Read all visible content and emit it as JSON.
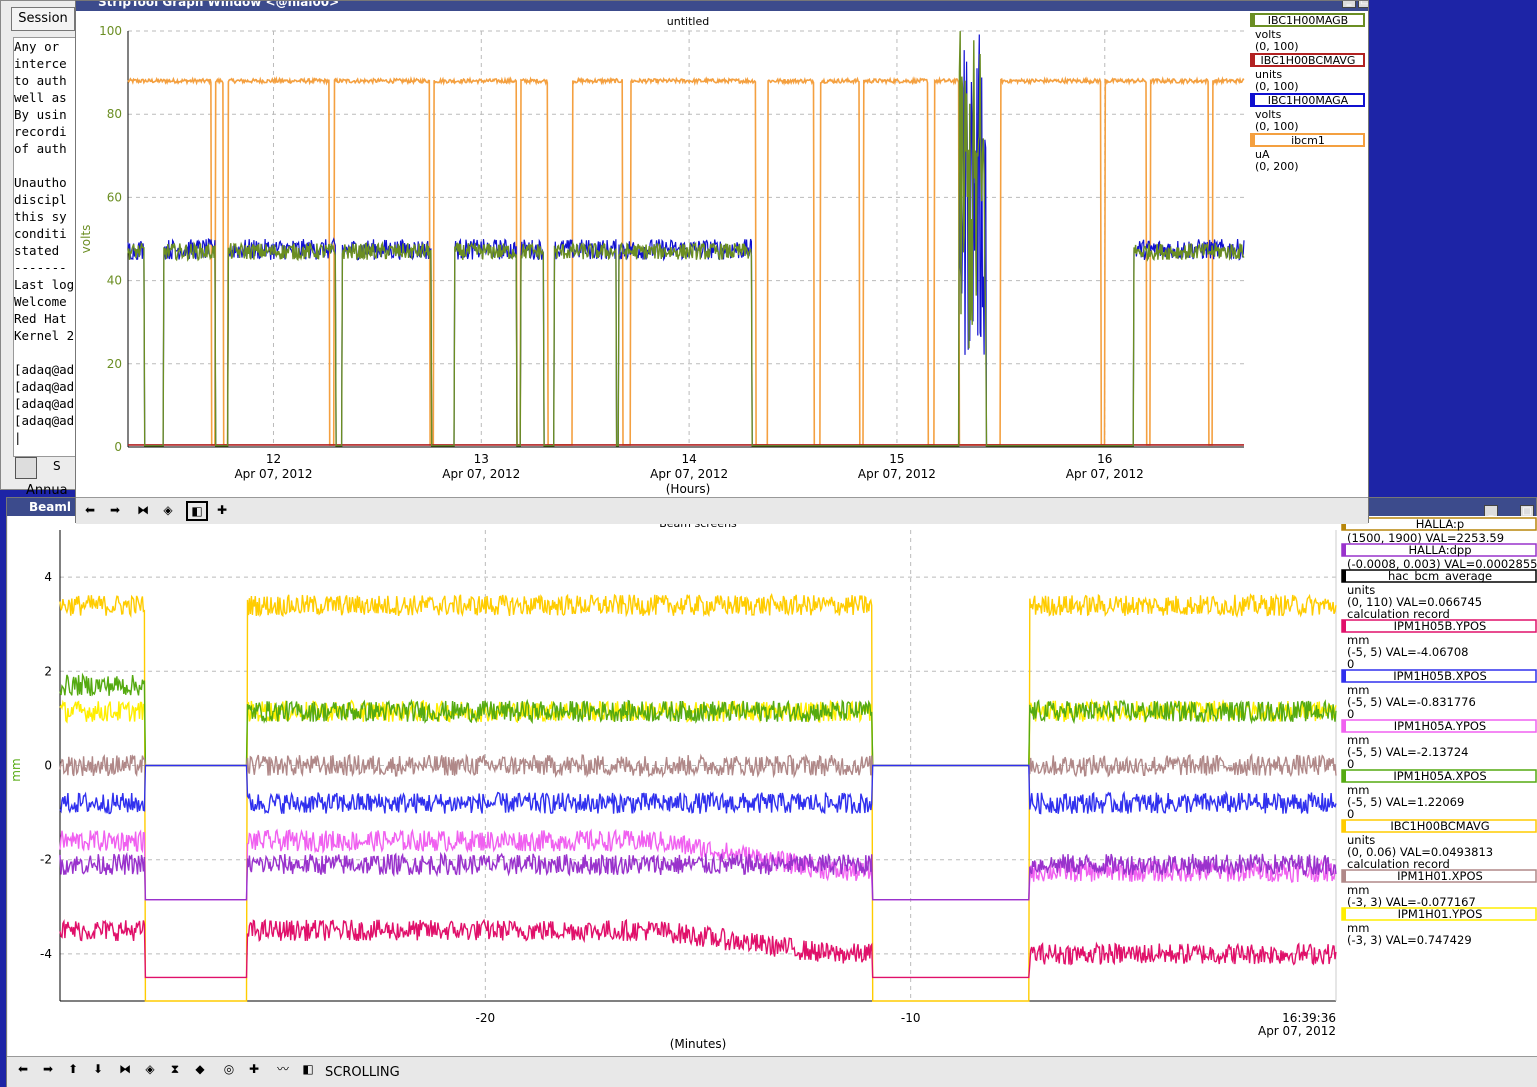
{
  "terminal": {
    "session_label": "Session",
    "lines": [
      "Any or",
      "interce",
      "to auth",
      "well as",
      "By usin",
      "recordi",
      "of auth",
      "",
      "Unautho",
      "discipl",
      "this sy",
      "conditi",
      "stated",
      "-------",
      "Last log",
      "Welcome",
      "Red Hat",
      "Kernel 2",
      "",
      "[adaq@ad",
      "[adaq@ad",
      "[adaq@ad",
      "[adaq@ad",
      "|"
    ],
    "taskbar_label": "S",
    "behind_label": "Annua"
  },
  "strip_window": {
    "title": "StripTool Graph Window <@hlal00>"
  },
  "beam_window": {
    "title": "Beaml",
    "mode_label": "SCROLLING"
  },
  "chart_data": [
    {
      "type": "line",
      "title": "untitled",
      "ylabel": "volts",
      "xlabel": "(Hours)",
      "ylim": [
        0,
        100
      ],
      "xlim": [
        11.3,
        16.67
      ],
      "yticks": [
        0,
        20,
        40,
        60,
        80,
        100
      ],
      "xticks": [
        12,
        13,
        14,
        15,
        16
      ],
      "xtick_date": "Apr 07, 2012",
      "grid": true,
      "legend": [
        {
          "name": "IBC1H00MAGB",
          "unit": "volts",
          "range": "(0, 100)",
          "color": "#6b8e23"
        },
        {
          "name": "IBC1H00BCMAVG",
          "unit": "units",
          "range": "(0, 100)",
          "color": "#b22222"
        },
        {
          "name": "IBC1H00MAGA",
          "unit": "volts",
          "range": "(0, 100)",
          "color": "#1010d0"
        },
        {
          "name": "ibcm1",
          "unit": "uA",
          "range": "(0, 200)",
          "color": "#f4a040"
        }
      ],
      "on_segments": [
        [
          11.3,
          11.38
        ],
        [
          11.47,
          11.72
        ],
        [
          11.78,
          12.3
        ],
        [
          12.33,
          12.76
        ],
        [
          12.87,
          13.17
        ],
        [
          13.19,
          13.3
        ],
        [
          13.35,
          13.65
        ],
        [
          13.66,
          14.3
        ],
        [
          15.3,
          15.43
        ],
        [
          16.14,
          16.67
        ]
      ],
      "ibcm1_high_segments": [
        [
          11.3,
          11.7
        ],
        [
          11.72,
          11.76
        ],
        [
          11.78,
          12.27
        ],
        [
          12.29,
          12.75
        ],
        [
          12.77,
          13.17
        ],
        [
          13.19,
          13.32
        ],
        [
          13.44,
          13.68
        ],
        [
          13.72,
          14.32
        ],
        [
          14.38,
          14.6
        ],
        [
          14.63,
          14.82
        ],
        [
          14.84,
          15.15
        ],
        [
          15.18,
          15.3
        ],
        [
          15.5,
          15.98
        ],
        [
          16.0,
          16.2
        ],
        [
          16.22,
          16.5
        ],
        [
          16.52,
          16.67
        ]
      ],
      "series_levels": {
        "IBC1H00MAGB": 47,
        "IBC1H00MAGA": 47.5,
        "IBC1H00BCMAVG": 0.5,
        "ibcm1": 88
      }
    },
    {
      "type": "line",
      "title": "Beam screens",
      "ylabel": "mm",
      "xlabel": "(Minutes)",
      "ylim": [
        -5,
        5
      ],
      "xlim": [
        -30,
        0
      ],
      "yticks": [
        -4,
        -2,
        0,
        2,
        4
      ],
      "xticks": [
        -20,
        -10
      ],
      "end_time": "16:39:36",
      "end_date": "Apr 07, 2012",
      "grid": true,
      "legend": [
        {
          "name": "HALLA:p",
          "line2": "(1500, 1900) VAL=2253.59",
          "color": "#b8860b"
        },
        {
          "name": "HALLA:dpp",
          "line2": "(-0.0008, 0.003) VAL=0.0002855",
          "color": "#9932cc"
        },
        {
          "name": "hac_bcm_average",
          "line2": "units",
          "line3": "(0, 110) VAL=0.066745",
          "line4": "calculation record",
          "color": "#000000"
        },
        {
          "name": "IPM1H05B.YPOS",
          "line2": "mm",
          "line3": "(-5, 5) VAL=-4.06708",
          "line4": "0",
          "color": "#e0106a"
        },
        {
          "name": "IPM1H05B.XPOS",
          "line2": "mm",
          "line3": "(-5, 5) VAL=-0.831776",
          "line4": "0",
          "color": "#3030ee"
        },
        {
          "name": "IPM1H05A.YPOS",
          "line2": "mm",
          "line3": "(-5, 5) VAL=-2.13724",
          "line4": "0",
          "color": "#f060f0"
        },
        {
          "name": "IPM1H05A.XPOS",
          "line2": "mm",
          "line3": "(-5, 5) VAL=1.22069",
          "line4": "0",
          "color": "#55aa11"
        },
        {
          "name": "IBC1H00BCMAVG",
          "line2": "units",
          "line3": "(0, 0.06) VAL=0.0493813",
          "line4": "calculation record",
          "color": "#ffcc00"
        },
        {
          "name": "IPM1H01.XPOS",
          "line2": "mm",
          "line3": "(-3, 3) VAL=-0.077167",
          "color": "#b08888"
        },
        {
          "name": "IPM1H01.YPOS",
          "line2": "mm",
          "line3": "(-3, 3) VAL=0.747429",
          "color": "#ffee00"
        }
      ],
      "off_segments": [
        [
          -28.0,
          -25.6
        ],
        [
          -10.9,
          -7.2
        ]
      ],
      "series": [
        {
          "name": "IBC1H00BCMAVG",
          "level": 3.4,
          "off": -5.0,
          "color": "#ffcc00"
        },
        {
          "name": "IPM1H01.YPOS",
          "level": 1.15,
          "off": 0.0,
          "color": "#ffee00"
        },
        {
          "name": "IPM1H05A.XPOS",
          "level": 1.15,
          "off": 0.0,
          "color": "#55aa11"
        },
        {
          "name": "IPM1H01.XPOS",
          "level": 0.0,
          "off": 0.0,
          "color": "#b08888"
        },
        {
          "name": "IPM1H05B.XPOS",
          "level": -0.8,
          "off": 0.0,
          "color": "#3030ee"
        },
        {
          "name": "IPM1H05A.YPOS",
          "level": -1.6,
          "off": -2.85,
          "color": "#f060f0"
        },
        {
          "name": "HALLA:dpp",
          "level": -2.1,
          "off": -2.85,
          "color": "#9932cc"
        },
        {
          "name": "IPM1H05B.YPOS",
          "level": -3.5,
          "off": -4.5,
          "color": "#e0106a"
        }
      ]
    }
  ]
}
